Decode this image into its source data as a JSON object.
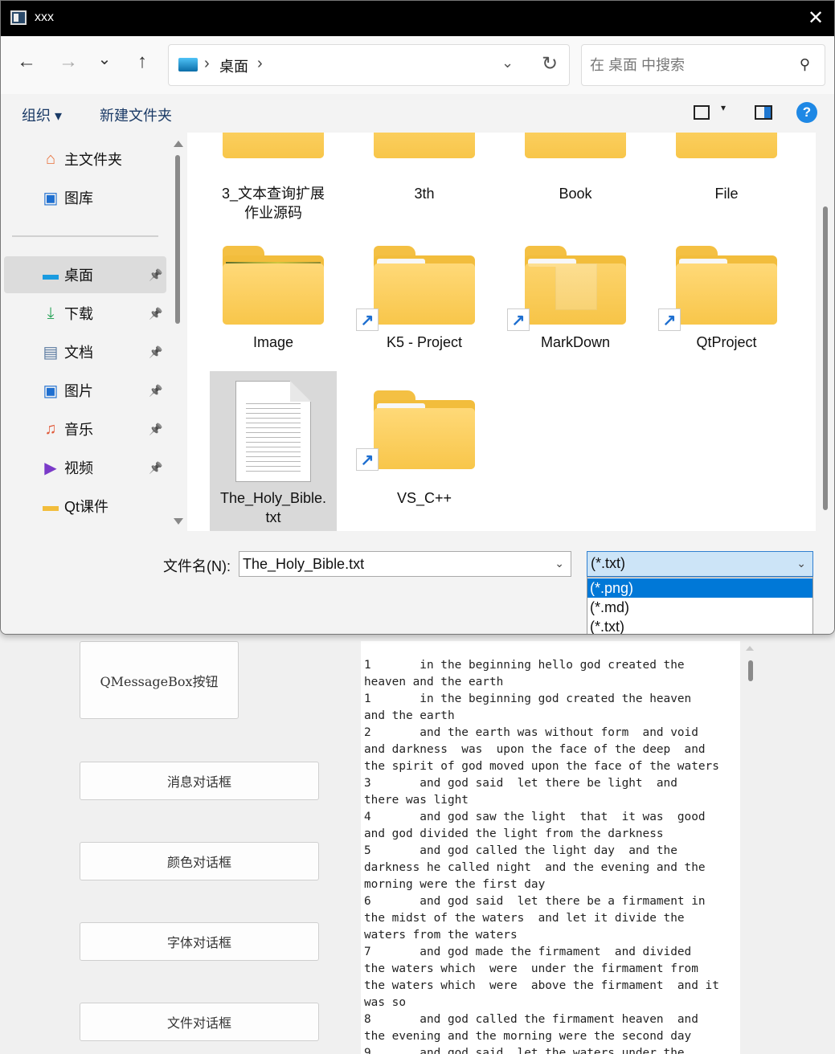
{
  "window": {
    "title": "xxx",
    "close_glyph": "✕"
  },
  "nav": {
    "back": "←",
    "forward": "→",
    "recent": "⌄",
    "up": "↑"
  },
  "address": {
    "separator": "›",
    "crumb": "桌面",
    "dropdown": "⌄",
    "refresh": "↻"
  },
  "search": {
    "placeholder": "在 桌面 中搜索",
    "icon": "⚲"
  },
  "toolbar": {
    "organize": "组织 ▾",
    "new_folder": "新建文件夹",
    "view_dropdown": "▾",
    "help": "?"
  },
  "sidebar": {
    "items": [
      {
        "label": "主文件夹",
        "icon": "home-icon",
        "glyph": "⌂",
        "color": "#e8703a",
        "pinned": false
      },
      {
        "label": "图库",
        "icon": "gallery-icon",
        "glyph": "▣",
        "color": "#1e6fd0",
        "pinned": false
      },
      {
        "label": "桌面",
        "icon": "desktop-icon",
        "glyph": "▬",
        "color": "#1a9be0",
        "pinned": true,
        "selected": true
      },
      {
        "label": "下载",
        "icon": "download-icon",
        "glyph": "⤓",
        "color": "#2aa45a",
        "pinned": true
      },
      {
        "label": "文档",
        "icon": "document-icon",
        "glyph": "▤",
        "color": "#5a7aa0",
        "pinned": true
      },
      {
        "label": "图片",
        "icon": "pictures-icon",
        "glyph": "▣",
        "color": "#1e6fd0",
        "pinned": true
      },
      {
        "label": "音乐",
        "icon": "music-icon",
        "glyph": "♫",
        "color": "#e05a3a",
        "pinned": true
      },
      {
        "label": "视频",
        "icon": "video-icon",
        "glyph": "▶",
        "color": "#7a3ac8",
        "pinned": true
      },
      {
        "label": "Qt课件",
        "icon": "folder-icon",
        "glyph": "▬",
        "color": "#f2bd3c",
        "pinned": false
      }
    ],
    "pin_glyph": "📌"
  },
  "files": [
    {
      "label": "3_文本查询扩展\n作业源码",
      "type": "folder"
    },
    {
      "label": "3th",
      "type": "folder"
    },
    {
      "label": "Book",
      "type": "folder"
    },
    {
      "label": "File",
      "type": "folder"
    },
    {
      "label": "Image",
      "type": "folder-photo"
    },
    {
      "label": "K5 - Project",
      "type": "folder-shortcut"
    },
    {
      "label": "MarkDown",
      "type": "folder-shortcut-doc"
    },
    {
      "label": "QtProject",
      "type": "folder-shortcut"
    },
    {
      "label": "The_Holy_Bible.\ntxt",
      "type": "text-file",
      "selected": true
    },
    {
      "label": "VS_C++",
      "type": "folder-shortcut"
    }
  ],
  "shortcut_glyph": "↗",
  "bottom": {
    "filename_label": "文件名(N):",
    "filename_value": "The_Holy_Bible.txt",
    "filetype_value": "(*.txt)",
    "dropdown": "⌄",
    "filetype_options": [
      {
        "label": "(*.png)",
        "highlighted": true
      },
      {
        "label": "(*.md)",
        "highlighted": false
      },
      {
        "label": "(*.txt)",
        "highlighted": false
      }
    ]
  },
  "app": {
    "buttons": {
      "messagebox": "QMessageBox按钮",
      "message_dialog": "消息对话框",
      "color_dialog": "颜色对话框",
      "font_dialog": "字体对话框",
      "file_dialog": "文件对话框"
    },
    "text_content": "1       in the beginning hello god created the\nheaven and the earth\n1       in the beginning god created the heaven\nand the earth\n2       and the earth was without form  and void\nand darkness  was  upon the face of the deep  and\nthe spirit of god moved upon the face of the waters\n3       and god said  let there be light  and\nthere was light\n4       and god saw the light  that  it was  good\nand god divided the light from the darkness\n5       and god called the light day  and the\ndarkness he called night  and the evening and the\nmorning were the first day\n6       and god said  let there be a firmament in\nthe midst of the waters  and let it divide the\nwaters from the waters\n7       and god made the firmament  and divided\nthe waters which  were  under the firmament from\nthe waters which  were  above the firmament  and it\nwas so\n8       and god called the firmament heaven  and\nthe evening and the morning were the second day\n9       and god said  let the waters under the"
  }
}
